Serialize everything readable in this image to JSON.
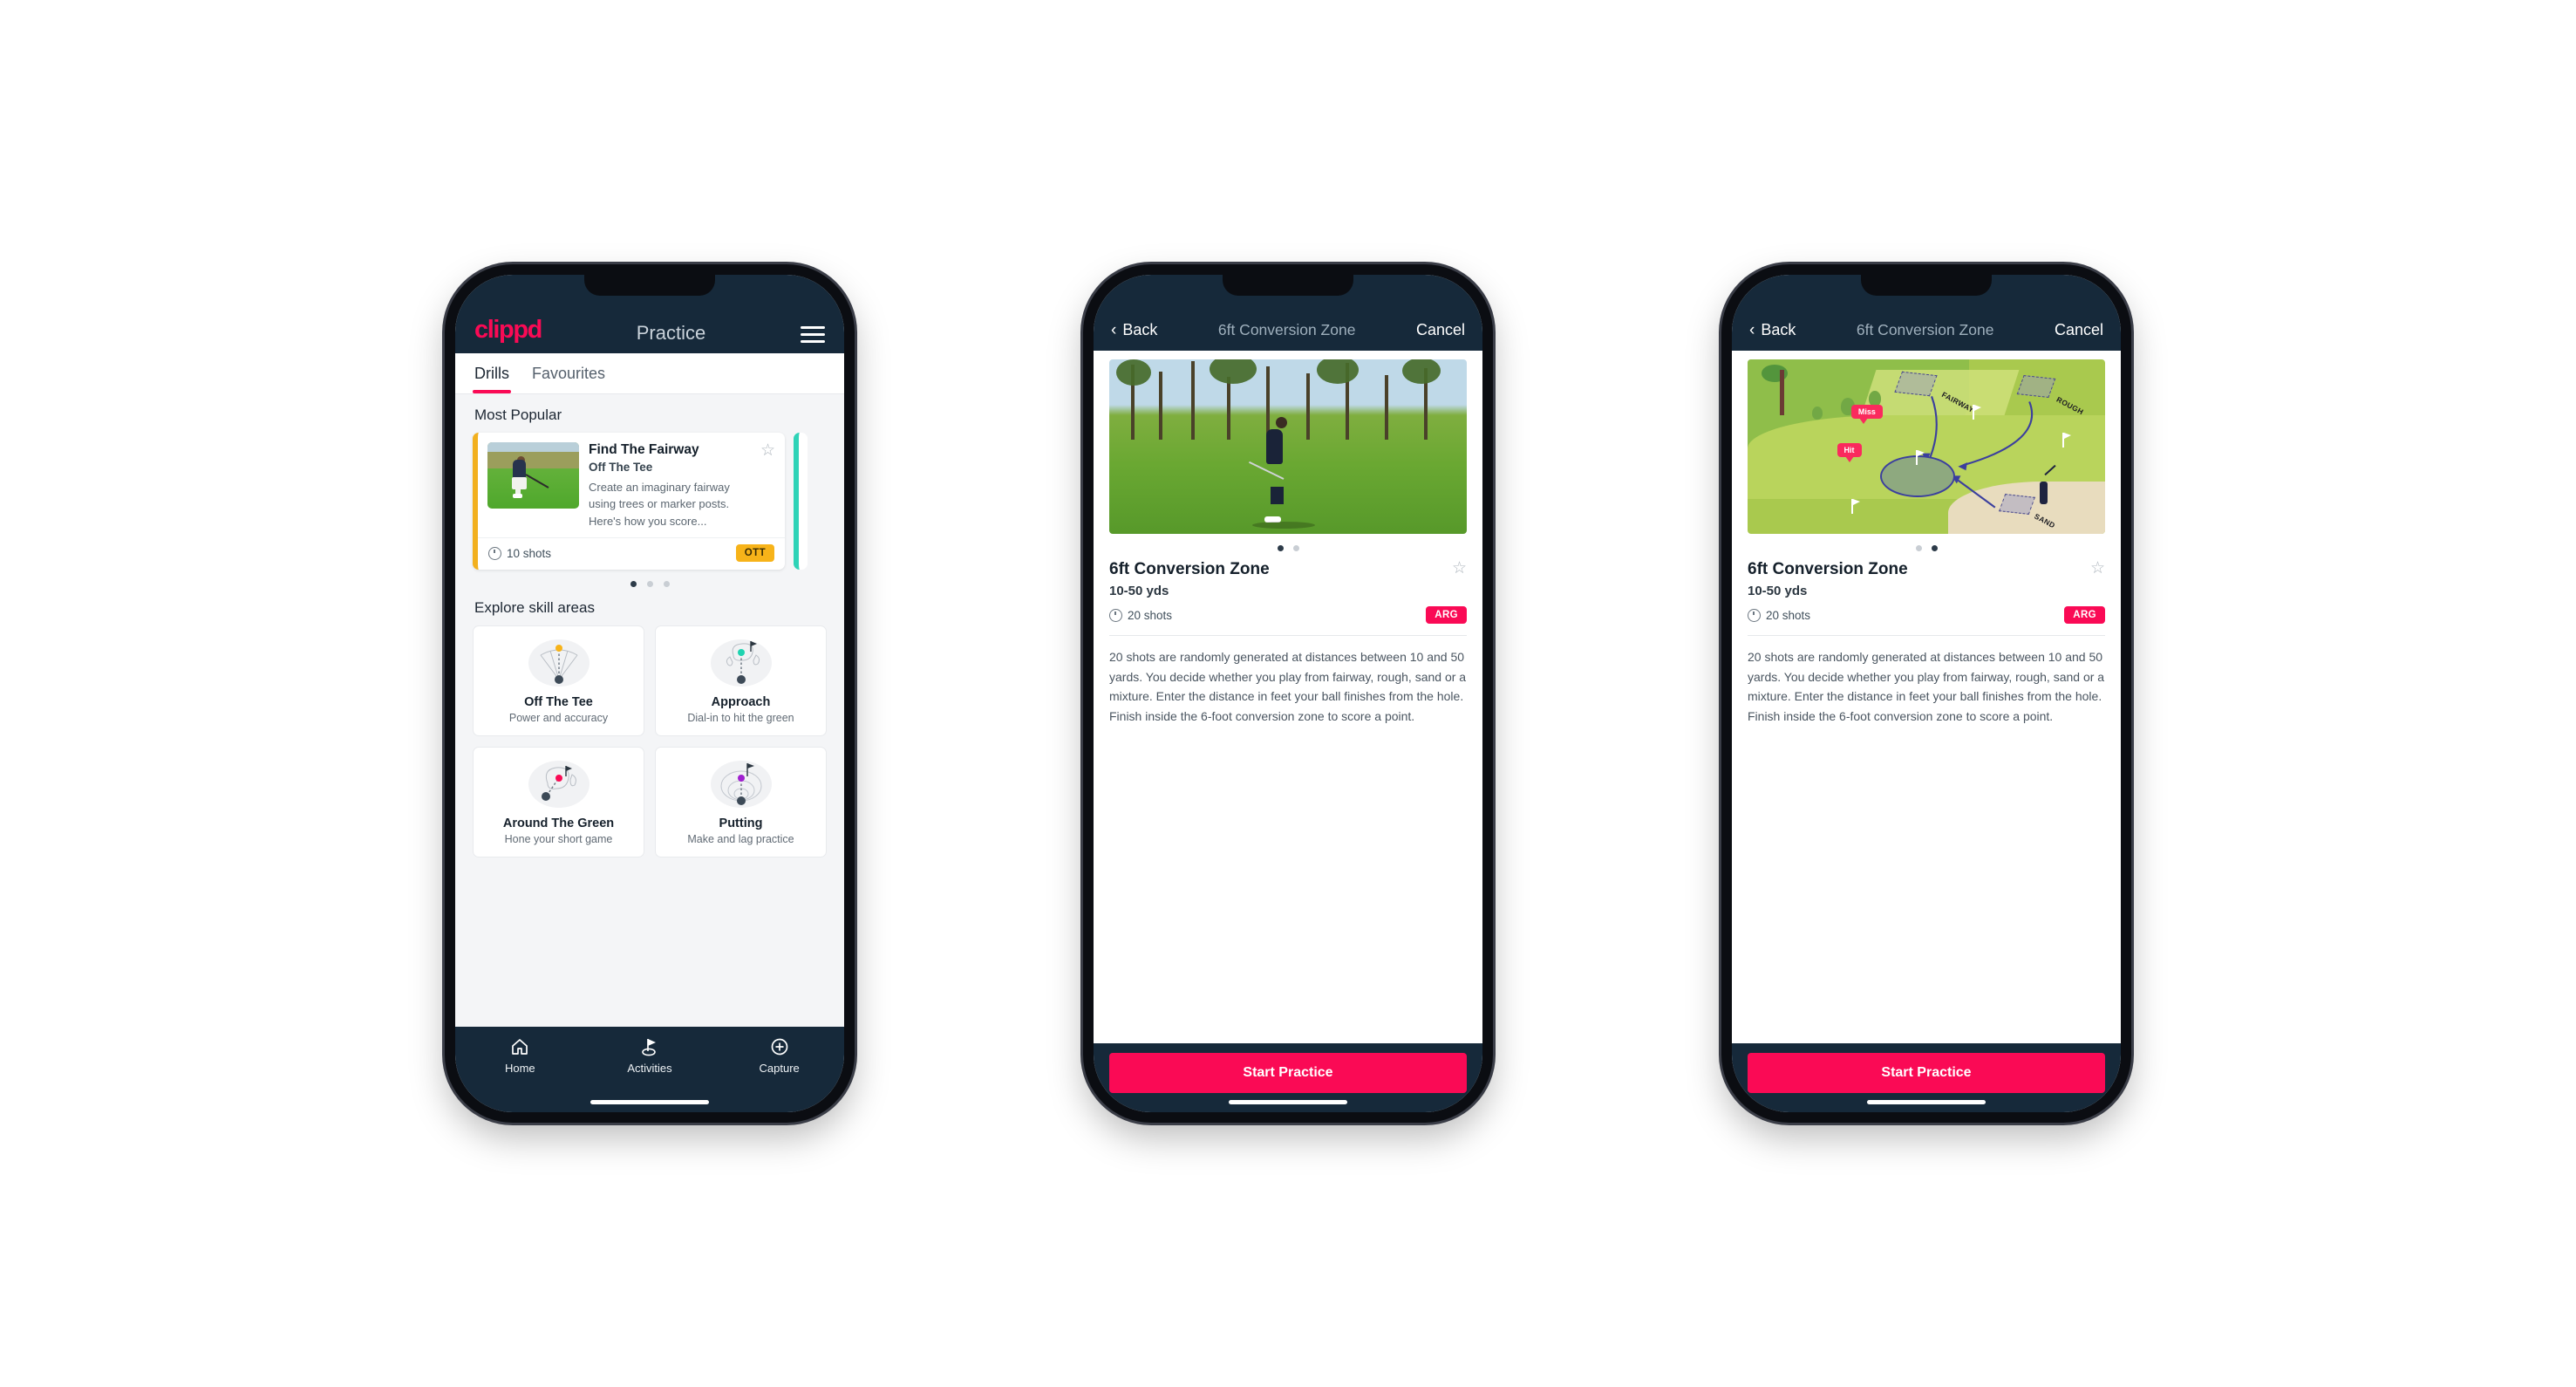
{
  "phone1": {
    "navbar": {
      "logo": "clippd",
      "title": "Practice",
      "menu_icon": "hamburger-icon"
    },
    "tabs": [
      {
        "label": "Drills",
        "active": true
      },
      {
        "label": "Favourites",
        "active": false
      }
    ],
    "sections": {
      "most_popular": "Most Popular",
      "explore": "Explore skill areas"
    },
    "drill_card": {
      "title": "Find The Fairway",
      "subtitle": "Off The Tee",
      "description": "Create an imaginary fairway using trees or marker posts. Here's how you score...",
      "shots": "10 shots",
      "badge": "OTT",
      "badge_color": "#f7b319",
      "accent_color": "#f2b01e",
      "star_icon": "star-outline-icon"
    },
    "carousel_dots": 3,
    "carousel_active": 0,
    "skills": [
      {
        "title": "Off The Tee",
        "desc": "Power and accuracy",
        "dot_color": "#f7b319"
      },
      {
        "title": "Approach",
        "desc": "Dial-in to hit the green",
        "dot_color": "#1fd3b0"
      },
      {
        "title": "Around The Green",
        "desc": "Hone your short game",
        "dot_color": "#fa0a55"
      },
      {
        "title": "Putting",
        "desc": "Make and lag practice",
        "dot_color": "#a020d0"
      }
    ],
    "tabbar": [
      {
        "label": "Home",
        "icon": "home-icon"
      },
      {
        "label": "Activities",
        "icon": "golf-flag-icon"
      },
      {
        "label": "Capture",
        "icon": "plus-circle-icon"
      }
    ]
  },
  "phone2": {
    "navbar": {
      "back": "Back",
      "title": "6ft Conversion Zone",
      "cancel": "Cancel"
    },
    "hero": "golfer-chipping-photo",
    "carousel_dots": 2,
    "carousel_active": 0,
    "detail": {
      "title": "6ft Conversion Zone",
      "distance": "10-50 yds",
      "shots": "20 shots",
      "badge": "ARG",
      "badge_color": "#fa0a55",
      "star_icon": "star-outline-icon",
      "description": "20 shots are randomly generated at distances between 10 and 50 yards. You decide whether you play from fairway, rough, sand or a mixture. Enter the distance in feet your ball finishes from the hole. Finish inside the 6-foot conversion zone to score a point."
    },
    "cta": "Start Practice"
  },
  "phone3": {
    "navbar": {
      "back": "Back",
      "title": "6ft Conversion Zone",
      "cancel": "Cancel"
    },
    "hero": "course-diagram-illustration",
    "diagram": {
      "zones": [
        "FAIRWAY",
        "ROUGH",
        "SAND"
      ],
      "markers": [
        "Miss",
        "Hit"
      ]
    },
    "carousel_dots": 2,
    "carousel_active": 1,
    "detail": {
      "title": "6ft Conversion Zone",
      "distance": "10-50 yds",
      "shots": "20 shots",
      "badge": "ARG",
      "badge_color": "#fa0a55",
      "star_icon": "star-outline-icon",
      "description": "20 shots are randomly generated at distances between 10 and 50 yards. You decide whether you play from fairway, rough, sand or a mixture. Enter the distance in feet your ball finishes from the hole. Finish inside the 6-foot conversion zone to score a point."
    },
    "cta": "Start Practice"
  }
}
